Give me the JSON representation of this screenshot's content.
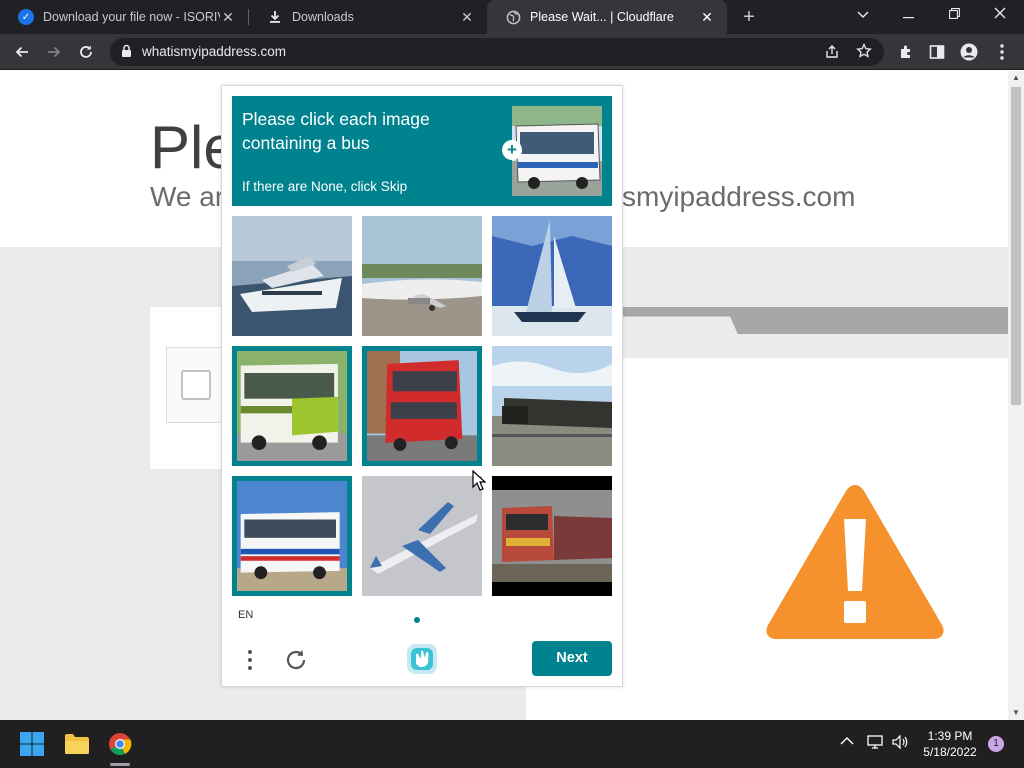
{
  "browser": {
    "tabs": [
      {
        "title": "Download your file now - ISORIV",
        "favicon": "check-circle-icon",
        "active": false
      },
      {
        "title": "Downloads",
        "favicon": "download-icon",
        "active": false
      },
      {
        "title": "Please Wait... | Cloudflare",
        "favicon": "globe-icon",
        "active": true
      }
    ],
    "url": "whatismyipaddress.com"
  },
  "page": {
    "title_partial": "Ple",
    "subtitle_partial_left": "We ar",
    "subtitle_partial_right": "smyipaddress.com",
    "warning_color": "#f5922d"
  },
  "captcha": {
    "prompt": "Please click each image containing a bus",
    "skip_hint": "If there are None, click Skip",
    "accent_color": "#00838f",
    "tiles": [
      {
        "subject": "yacht",
        "selected": false
      },
      {
        "subject": "airplane on runway",
        "selected": false
      },
      {
        "subject": "sailboat",
        "selected": false
      },
      {
        "subject": "green bus",
        "selected": true
      },
      {
        "subject": "red double-decker bus",
        "selected": true
      },
      {
        "subject": "train",
        "selected": false
      },
      {
        "subject": "white bus",
        "selected": true
      },
      {
        "subject": "airplane in flight",
        "selected": false
      },
      {
        "subject": "train",
        "selected": false
      }
    ],
    "language": "EN",
    "next_label": "Next"
  },
  "taskbar": {
    "time": "1:39 PM",
    "date": "5/18/2022",
    "notification_count": "1"
  }
}
